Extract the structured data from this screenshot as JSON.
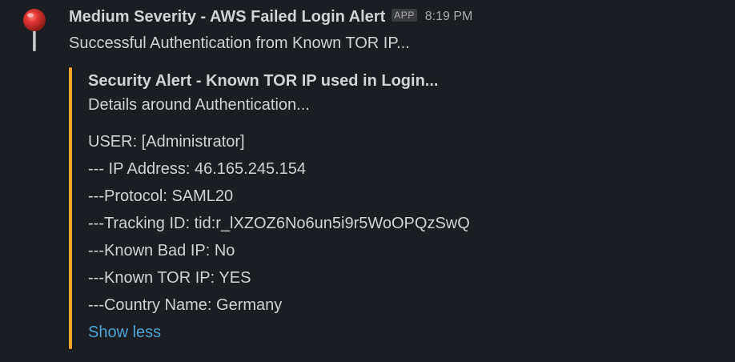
{
  "message": {
    "sender": "Medium Severity - AWS Failed Login Alert",
    "badge": "APP",
    "time": "8:19 PM",
    "summary": "Successful Authentication from Known TOR IP...",
    "avatar_icon": "pushpin-icon",
    "attachment": {
      "color": "#f0a528",
      "title": "Security Alert - Known TOR IP used in Login...",
      "subtitle": "Details around Authentication...",
      "lines": [
        "USER: [Administrator]",
        "--- IP Address: 46.165.245.154",
        "---Protocol: SAML20",
        "---Tracking ID: tid:r_lXZOZ6No6un5i9r5WoOPQzSwQ",
        "---Known Bad IP: No",
        "---Known TOR IP: YES",
        "---Country Name: Germany"
      ],
      "toggle_label": "Show less"
    }
  }
}
